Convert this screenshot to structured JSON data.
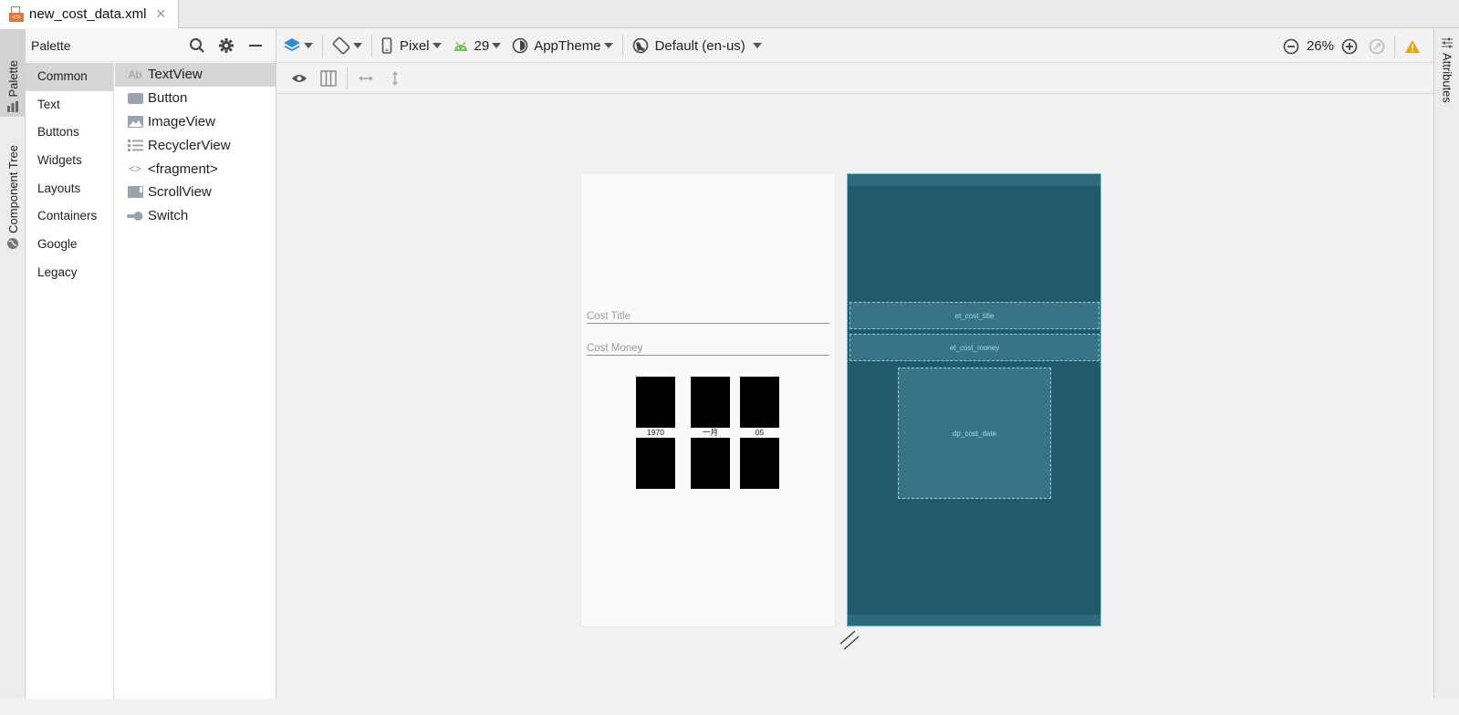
{
  "file_tab": {
    "name": "new_cost_data.xml",
    "icon_badge": "<>",
    "close": "✕"
  },
  "left_strip": {
    "palette_label": "Palette",
    "tree_label": "Component Tree"
  },
  "right_strip": {
    "attributes_label": "Attributes"
  },
  "palette": {
    "title": "Palette",
    "categories": [
      {
        "label": "Common",
        "selected": true
      },
      {
        "label": "Text"
      },
      {
        "label": "Buttons"
      },
      {
        "label": "Widgets"
      },
      {
        "label": "Layouts"
      },
      {
        "label": "Containers"
      },
      {
        "label": "Google"
      },
      {
        "label": "Legacy"
      }
    ],
    "widgets": [
      {
        "label": "TextView",
        "icon": "textview-icon",
        "glyph": "Ab",
        "selected": true
      },
      {
        "label": "Button",
        "icon": "button-icon"
      },
      {
        "label": "ImageView",
        "icon": "imageview-icon"
      },
      {
        "label": "RecyclerView",
        "icon": "recyclerview-icon"
      },
      {
        "label": "<fragment>",
        "icon": "fragment-icon",
        "glyph": "<>"
      },
      {
        "label": "ScrollView",
        "icon": "scrollview-icon"
      },
      {
        "label": "Switch",
        "icon": "switch-icon"
      }
    ]
  },
  "toolbar": {
    "device": "Pixel",
    "api": "29",
    "theme": "AppTheme",
    "locale": "Default (en-us)",
    "zoom": "26%"
  },
  "design": {
    "title_hint": "Cost Title",
    "money_hint": "Cost Money",
    "date": {
      "year": "1970",
      "month": "一月",
      "day": "05"
    }
  },
  "blueprint": {
    "title_id": "et_cost_title",
    "money_id": "et_cost_money",
    "date_id": "dp_cost_date"
  },
  "colors": {
    "blueprint_bg": "#225a6c",
    "blueprint_box": "#367486",
    "accent_blue": "#2e8bd6",
    "android_green": "#78c257",
    "warning": "#f0a30a"
  }
}
